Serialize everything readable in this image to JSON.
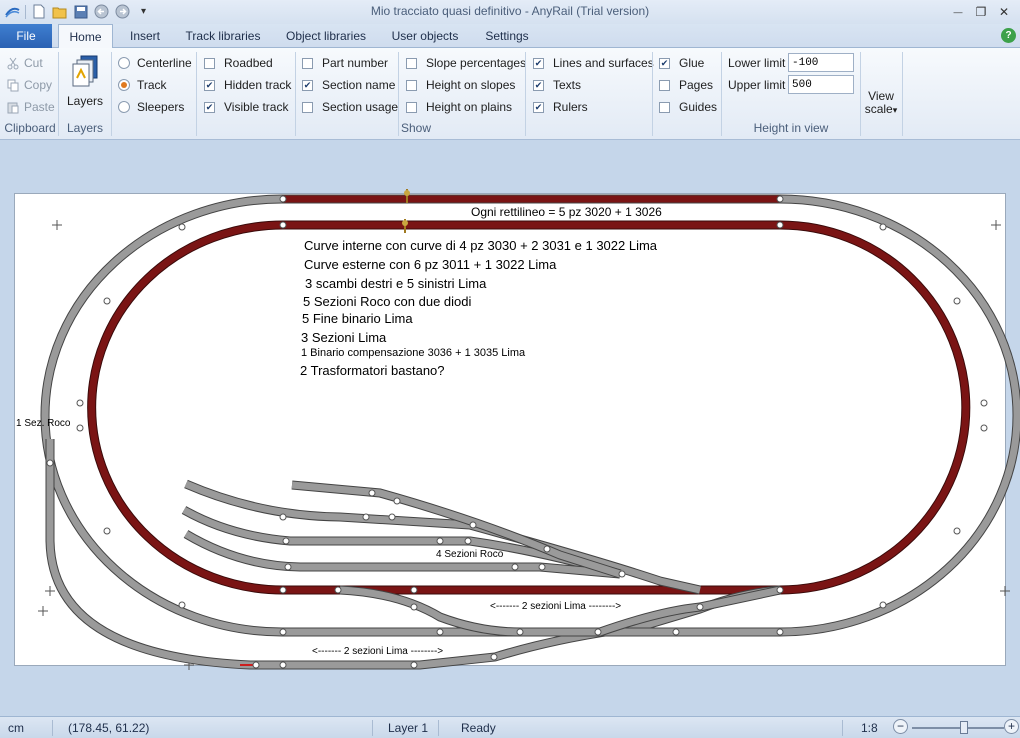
{
  "app": {
    "title": "Mio tracciato quasi definitivo - AnyRail (Trial version)"
  },
  "qat": {
    "icons": [
      "anyrail-logo-icon",
      "new-file-icon",
      "open-folder-icon",
      "save-icon",
      "undo-icon",
      "redo-icon",
      "customize-icon"
    ],
    "customize": "▾"
  },
  "window_controls": {
    "minimize": "—",
    "restore": "❐",
    "close": "✕"
  },
  "tabs": {
    "file": "File",
    "items": [
      "Home",
      "Insert",
      "Track libraries",
      "Object libraries",
      "User objects",
      "Settings"
    ],
    "active": "Home",
    "help": "?"
  },
  "ribbon": {
    "clipboard": {
      "cut": "Cut",
      "copy": "Copy",
      "paste": "Paste",
      "label": "Clipboard"
    },
    "layers": {
      "button": "Layers",
      "label": "Layers"
    },
    "show": {
      "label": "Show",
      "view_mode": [
        {
          "label": "Centerline",
          "selected": false
        },
        {
          "label": "Track",
          "selected": true
        },
        {
          "label": "Sleepers",
          "selected": false
        }
      ],
      "col2": [
        {
          "label": "Roadbed",
          "checked": false
        },
        {
          "label": "Hidden track",
          "checked": true
        },
        {
          "label": "Visible track",
          "checked": true
        }
      ],
      "col3": [
        {
          "label": "Part number",
          "checked": false
        },
        {
          "label": "Section name",
          "checked": true
        },
        {
          "label": "Section usage",
          "checked": false
        }
      ],
      "col4": [
        {
          "label": "Slope percentages",
          "checked": false
        },
        {
          "label": "Height on slopes",
          "checked": false
        },
        {
          "label": "Height on plains",
          "checked": false
        }
      ],
      "col5": [
        {
          "label": "Lines and surfaces",
          "checked": true
        },
        {
          "label": "Texts",
          "checked": true
        },
        {
          "label": "Rulers",
          "checked": true
        }
      ],
      "col6": [
        {
          "label": "Glue",
          "checked": true
        },
        {
          "label": "Pages",
          "checked": false
        },
        {
          "label": "Guides",
          "checked": false
        }
      ]
    },
    "height_in_view": {
      "label": "Height in view",
      "lower_label": "Lower limit",
      "lower_value": "-100",
      "upper_label": "Upper limit",
      "upper_value": "500"
    },
    "view_scale": {
      "line1": "View",
      "line2": "scale",
      "arrow": "▾"
    }
  },
  "canvas": {
    "notes": {
      "rettilineo": "Ogni rettilineo = 5 pz 3020 + 1 3026",
      "l1": "Curve interne con curve di 4 pz 3030 + 2 3031 e 1 3022 Lima",
      "l2": "Curve esterne con 6 pz 3011 + 1 3022 Lima",
      "l3": "3 scambi destri e 5 sinistri Lima",
      "l4": "5 Sezioni Roco con due diodi",
      "l5": "5 Fine binario Lima",
      "l6": "3 Sezioni Lima",
      "l7": "1 Binario compensazione 3036 + 1 3035 Lima",
      "l8": "2 Trasformatori bastano?",
      "sez_roco": "1 Sez. Roco",
      "quattro_roco": "4 Sezioni Roco",
      "due_lima_a": "<------- 2 sezioni Lima -------->",
      "due_lima_b": "<------- 2 sezioni Lima -------->"
    },
    "colors": {
      "track_gray": "#9a9a9a",
      "track_edge": "#4a4a4a",
      "section_red": "#7a1414",
      "sheet_bg": "#ffffff"
    }
  },
  "status": {
    "unit": "cm",
    "coords": "(178.45, 61.22)",
    "layer": "Layer 1",
    "state": "Ready",
    "scale": "1:8",
    "zoom_minus": "−",
    "zoom_plus": "+"
  }
}
